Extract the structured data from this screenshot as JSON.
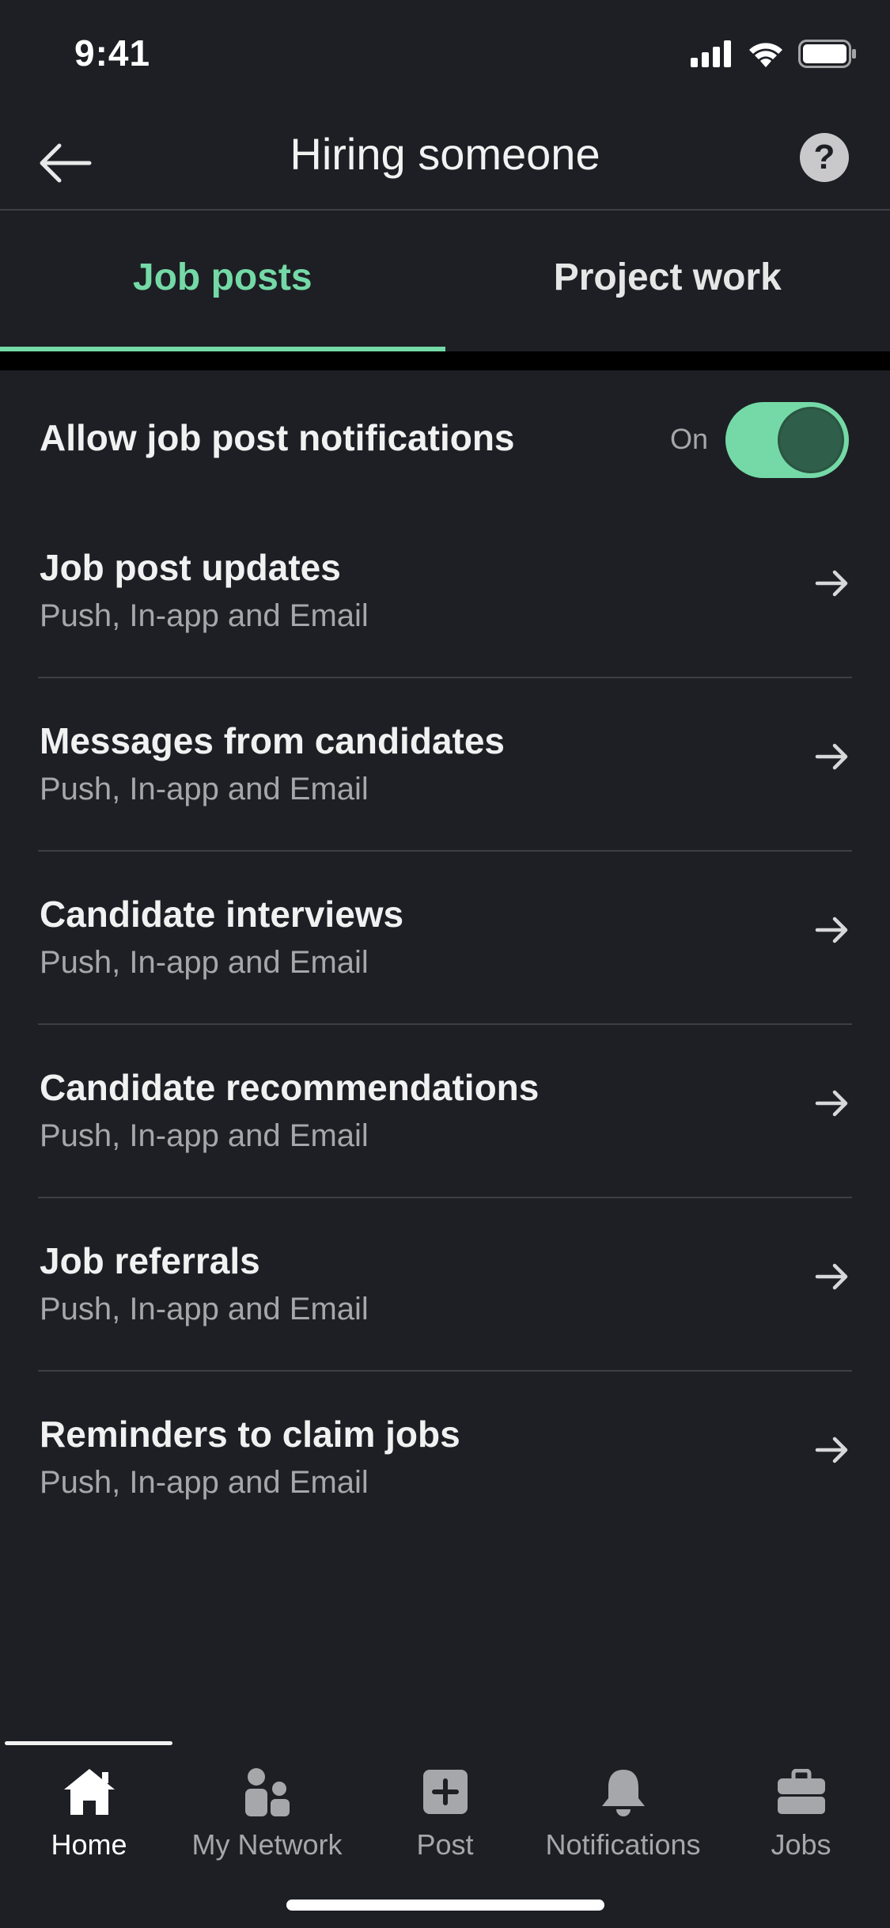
{
  "status_bar": {
    "time": "9:41"
  },
  "header": {
    "title": "Hiring someone"
  },
  "tabs": [
    {
      "label": "Job posts",
      "active": true
    },
    {
      "label": "Project work",
      "active": false
    }
  ],
  "toggle": {
    "label": "Allow job post notifications",
    "state": "On"
  },
  "items": [
    {
      "title": "Job post updates",
      "subtitle": "Push, In-app and Email"
    },
    {
      "title": "Messages from candidates",
      "subtitle": "Push, In-app and Email"
    },
    {
      "title": "Candidate interviews",
      "subtitle": "Push, In-app and Email"
    },
    {
      "title": "Candidate recommendations",
      "subtitle": "Push, In-app and Email"
    },
    {
      "title": "Job referrals",
      "subtitle": "Push, In-app and Email"
    },
    {
      "title": "Reminders to claim jobs",
      "subtitle": "Push, In-app and Email"
    }
  ],
  "bottom_nav": [
    {
      "label": "Home",
      "icon": "home-icon",
      "active": true
    },
    {
      "label": "My Network",
      "icon": "people-icon",
      "active": false
    },
    {
      "label": "Post",
      "icon": "plus-square-icon",
      "active": false
    },
    {
      "label": "Notifications",
      "icon": "bell-icon",
      "active": false
    },
    {
      "label": "Jobs",
      "icon": "briefcase-icon",
      "active": false
    }
  ],
  "colors": {
    "background": "#1d1f24",
    "accent": "#74d9a6",
    "text_primary": "#f1f1f2",
    "text_secondary": "#a6a7aa"
  }
}
